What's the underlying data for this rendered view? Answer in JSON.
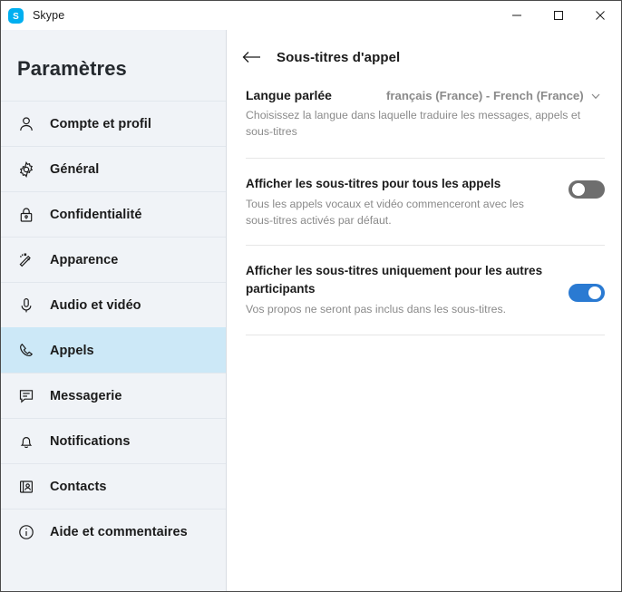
{
  "window": {
    "app_title": "Skype",
    "logo_icon": "skype-logo-icon",
    "controls": {
      "minimize": "minimize-icon",
      "maximize": "maximize-icon",
      "close": "close-icon"
    }
  },
  "sidebar": {
    "heading": "Paramètres",
    "items": [
      {
        "label": "Compte et profil",
        "icon": "person-icon",
        "selected": false
      },
      {
        "label": "Général",
        "icon": "gear-icon",
        "selected": false
      },
      {
        "label": "Confidentialité",
        "icon": "lock-icon",
        "selected": false
      },
      {
        "label": "Apparence",
        "icon": "magic-wand-icon",
        "selected": false
      },
      {
        "label": "Audio et vidéo",
        "icon": "microphone-icon",
        "selected": false
      },
      {
        "label": "Appels",
        "icon": "phone-icon",
        "selected": true
      },
      {
        "label": "Messagerie",
        "icon": "chat-bubble-icon",
        "selected": false
      },
      {
        "label": "Notifications",
        "icon": "bell-icon",
        "selected": false
      },
      {
        "label": "Contacts",
        "icon": "contact-card-icon",
        "selected": false
      },
      {
        "label": "Aide et commentaires",
        "icon": "info-icon",
        "selected": false
      }
    ]
  },
  "main": {
    "back_icon": "back-arrow-icon",
    "title": "Sous-titres d'appel",
    "language": {
      "label": "Langue parlée",
      "value": "français (France) - French (France)",
      "chevron_icon": "chevron-down-icon",
      "description": "Choisissez la langue dans laquelle traduire les messages, appels et sous-titres"
    },
    "settings": [
      {
        "title": "Afficher les sous-titres pour tous les appels",
        "description": "Tous les appels vocaux et vidéo commenceront avec les sous-titres activés par défaut.",
        "toggle_state": "off"
      },
      {
        "title": "Afficher les sous-titres uniquement pour les autres participants",
        "description": "Vos propos ne seront pas inclus dans les sous-titres.",
        "toggle_state": "on"
      }
    ]
  },
  "colors": {
    "accent": "#2a7ad2",
    "skype_blue": "#00aff0",
    "selected_bg": "#cce8f7",
    "sidebar_bg": "#f0f3f7",
    "toggle_off": "#6e6e6e",
    "muted_text": "#8a8a8a"
  }
}
